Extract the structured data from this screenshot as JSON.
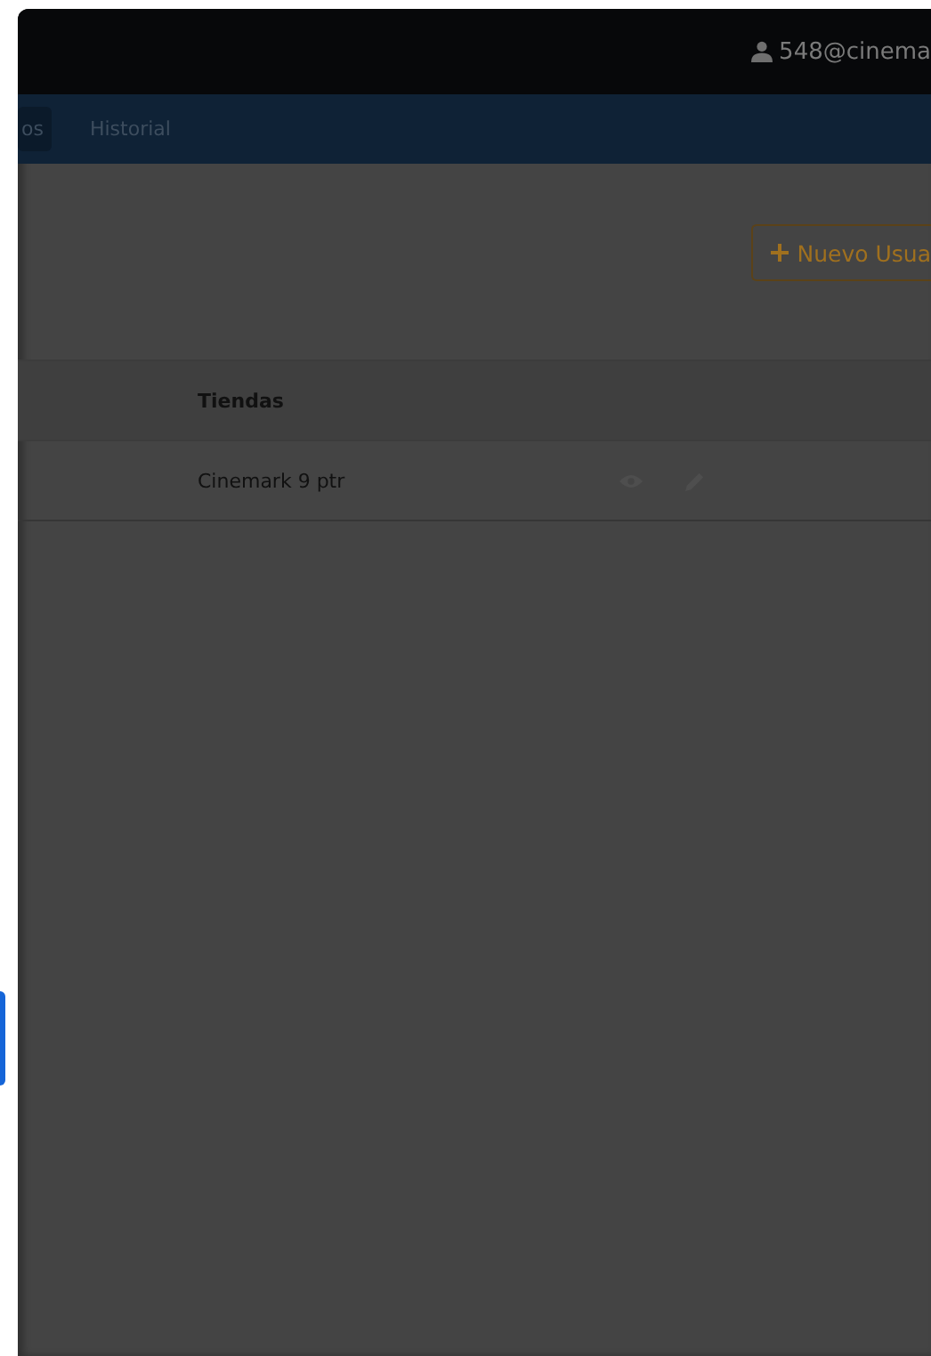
{
  "top_bar": {
    "user": "548@cinema"
  },
  "nav": {
    "tabs": [
      {
        "label": "os",
        "selected": true
      },
      {
        "label": "Historial",
        "selected": false
      }
    ]
  },
  "new_button": {
    "label": "Nuevo Usua"
  },
  "table": {
    "columns": [
      "Tiendas"
    ],
    "rows": [
      {
        "cells": [
          "Cinemark 9 ptr"
        ]
      }
    ]
  }
}
